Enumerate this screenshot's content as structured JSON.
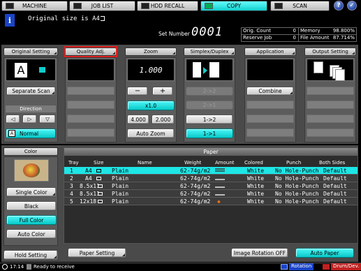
{
  "tabs": {
    "machine": "MACHINE",
    "job_list": "JOB LIST",
    "hdd_recall": "HDD RECALL",
    "copy": "COPY",
    "scan": "SCAN"
  },
  "message": "Original size is  A4",
  "set_number_label": "Set Number",
  "set_number_value": "0001",
  "counters": {
    "orig_count_label": "Orig. Count",
    "orig_count_value": "0",
    "reserve_job_label": "Reserve Job",
    "reserve_job_value": "0",
    "memory_label": "Memory",
    "memory_value": "98.800%",
    "file_amount_label": "File Amount",
    "file_amount_value": "87.714%"
  },
  "original_setting": {
    "header": "Original Setting",
    "letter": "A",
    "separate_scan": "Separate Scan",
    "direction_label": "Direction",
    "normal": "Normal"
  },
  "quality_adj": {
    "header": "Quality Adj."
  },
  "zoom": {
    "header": "Zoom",
    "value": "1.000",
    "minus": "−",
    "plus": "+",
    "x1": "x1.0",
    "preset1": "4.000",
    "preset2": "2.000",
    "auto_zoom": "Auto Zoom"
  },
  "simplex": {
    "header": "Simplex/Duplex",
    "b22": "2->2",
    "b21": "2->1",
    "b12": "1->2",
    "b11": "1->1"
  },
  "application": {
    "header": "Application",
    "combine": "Combine"
  },
  "output": {
    "header": "Output Setting"
  },
  "color": {
    "header": "Color",
    "single_color": "Single Color",
    "black": "Black",
    "full_color": "Full Color",
    "auto_color": "Auto Color"
  },
  "paper": {
    "header": "Paper",
    "columns": {
      "tray": "Tray",
      "size": "Size",
      "name": "Name",
      "weight": "Weight",
      "amount": "Amount",
      "colored": "Colored",
      "punch": "Punch",
      "both_sides": "Both Sides"
    },
    "rows": [
      {
        "tray": "1",
        "size": "A4",
        "type": "Plain",
        "weight": "62-74g/m2",
        "colored": "White",
        "punch": "No Hole-Punch",
        "both": "Default"
      },
      {
        "tray": "2",
        "size": "A4",
        "type": "Plain",
        "weight": "62-74g/m2",
        "colored": "White",
        "punch": "No Hole-Punch",
        "both": "Default"
      },
      {
        "tray": "3",
        "size": "8.5x11",
        "type": "Plain",
        "weight": "62-74g/m2",
        "colored": "White",
        "punch": "No Hole-Punch",
        "both": "Default"
      },
      {
        "tray": "4",
        "size": "8.5x11",
        "type": "Plain",
        "weight": "62-74g/m2",
        "colored": "White",
        "punch": "No Hole-Punch",
        "both": "Default"
      },
      {
        "tray": "5",
        "size": "12x18",
        "type": "Plain",
        "weight": "62-74g/m2",
        "colored": "White",
        "punch": "No Hole-Punch",
        "both": "Default"
      }
    ],
    "paper_setting": "Paper Setting",
    "image_rotation_off": "Image Rotation OFF",
    "auto_paper": "Auto Paper"
  },
  "hold_setting": "Hold Setting",
  "status": {
    "time": "17:14",
    "text": "Ready to receive",
    "rotation": "Rotation",
    "drum": "Drum/Dev."
  },
  "colors": {
    "accent_cyan": "#1ee6e6",
    "highlight_red": "#e02020"
  }
}
